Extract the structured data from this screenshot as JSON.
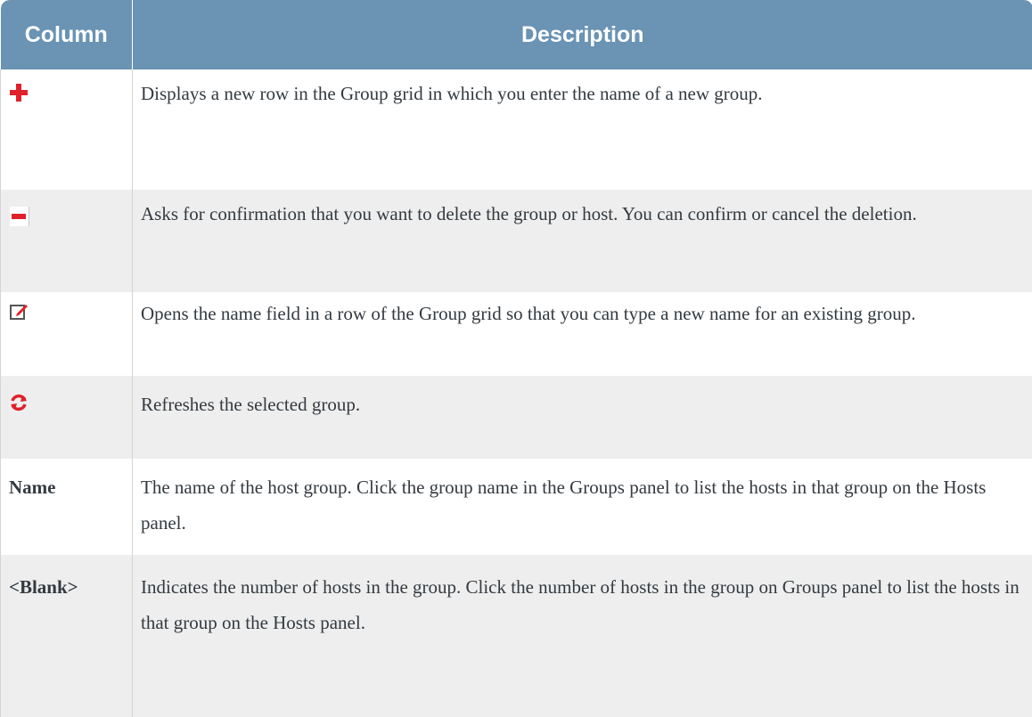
{
  "header": {
    "column_label": "Column",
    "description_label": "Description"
  },
  "rows": [
    {
      "icon": "plus-icon",
      "description": "Displays a new row in the Group grid in which you enter the name of a new group."
    },
    {
      "icon": "minus-icon",
      "description": "Asks for confirmation that you want to delete the group or host. You can confirm or cancel the deletion."
    },
    {
      "icon": "edit-icon",
      "description": "Opens the name field in a row of the Group grid so that you can type a new name for an existing group."
    },
    {
      "icon": "refresh-icon",
      "description": "Refreshes the selected group."
    },
    {
      "label": "Name",
      "description": "The name of the host group. Click the group name in the Groups panel to list the hosts in that group on the Hosts panel."
    },
    {
      "label": "<Blank>",
      "description": "Indicates the number of hosts in the group. Click the number of hosts in the group on Groups panel to list the hosts in that group on the Hosts panel."
    }
  ],
  "colors": {
    "header_bg": "#6a93b4",
    "icon_red": "#e0202a"
  }
}
